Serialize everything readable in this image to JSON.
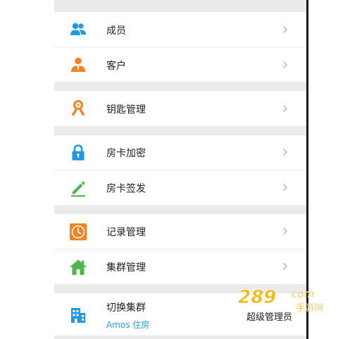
{
  "menu": {
    "members": {
      "label": "成员",
      "icon": "members-icon",
      "color": "#1a9ae8"
    },
    "customers": {
      "label": "客户",
      "icon": "customer-icon",
      "color": "#f5831f"
    },
    "keys": {
      "label": "钥匙管理",
      "icon": "key-icon",
      "color": "#f5831f"
    },
    "card_encrypt": {
      "label": "房卡加密",
      "icon": "lock-icon",
      "color": "#1a9ae8"
    },
    "card_issue": {
      "label": "房卡签发",
      "icon": "pencil-icon",
      "color": "#4cb848"
    },
    "records": {
      "label": "记录管理",
      "icon": "clock-icon",
      "color": "#f5831f"
    },
    "clusters": {
      "label": "集群管理",
      "icon": "house-icon",
      "color": "#4cb848"
    },
    "switch_cluster": {
      "label": "切换集群",
      "sublabel": "Amos 住房",
      "role": "超级管理员",
      "icon": "building-icon",
      "color": "#1a9ae8"
    }
  },
  "watermark": {
    "text_main": "289",
    "text_suffix": "com",
    "text_sub": "手游网",
    "color": "#ffb400"
  }
}
